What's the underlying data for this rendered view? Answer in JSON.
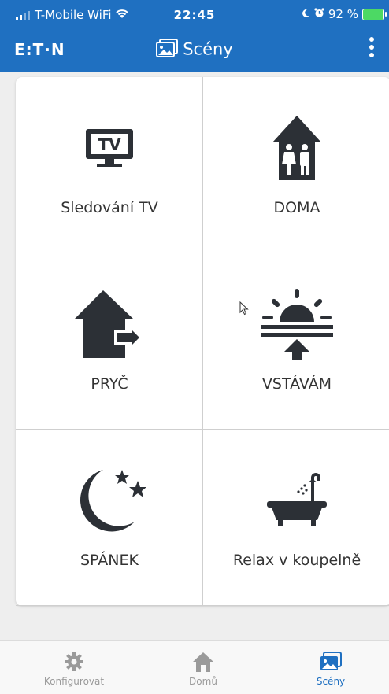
{
  "status_bar": {
    "carrier": "T-Mobile WiFi",
    "time": "22:45",
    "battery_percent": "92 %",
    "icons": [
      "signal-icon",
      "wifi-icon",
      "moon-icon",
      "alarm-icon",
      "battery-charging-icon"
    ]
  },
  "header": {
    "logo": "E:T·N",
    "title": "Scény",
    "title_icon": "scenes-icon",
    "menu_icon": "more-vertical-icon"
  },
  "scenes": [
    {
      "label": "Sledování TV",
      "icon": "tv-icon"
    },
    {
      "label": "DOMA",
      "icon": "home-people-icon"
    },
    {
      "label": "PRYČ",
      "icon": "house-exit-icon"
    },
    {
      "label": "VSTÁVÁM",
      "icon": "sunrise-icon"
    },
    {
      "label": "SPÁNEK",
      "icon": "moon-stars-icon"
    },
    {
      "label": "Relax v koupelně",
      "icon": "bathtub-icon"
    }
  ],
  "bottom_nav": {
    "items": [
      {
        "label": "Konfigurovat",
        "icon": "gear-icon"
      },
      {
        "label": "Domů",
        "icon": "home-icon"
      },
      {
        "label": "Scény",
        "icon": "scenes-icon"
      }
    ],
    "active_index": 2
  },
  "colors": {
    "brand_blue": "#1f70c1",
    "icon_dark": "#2c3036",
    "active_nav": "#1f70c1",
    "inactive_nav": "#9a9a9a"
  }
}
